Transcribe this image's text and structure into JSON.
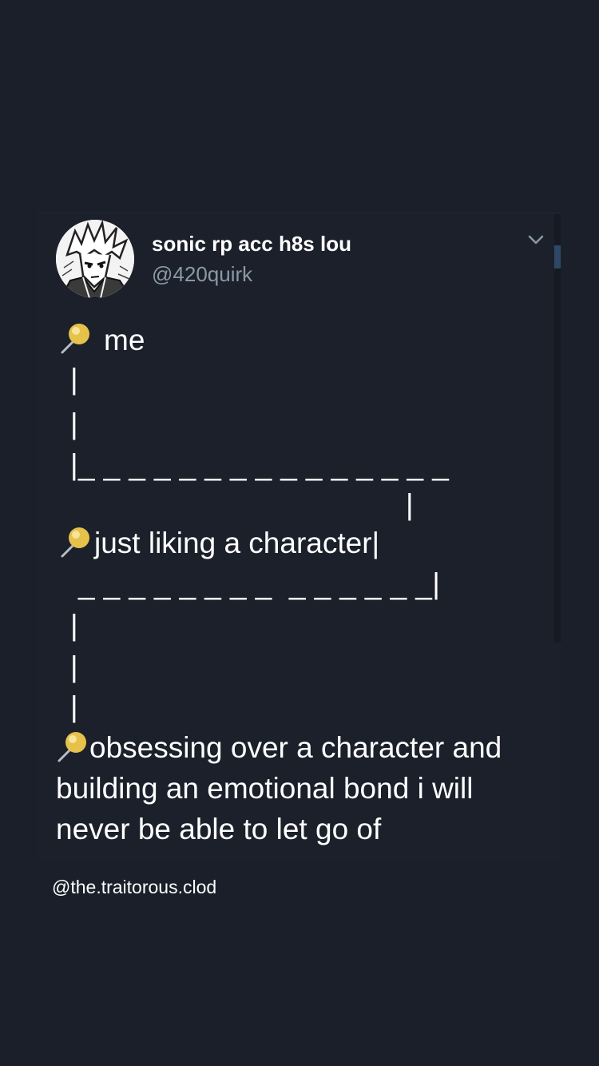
{
  "tweet": {
    "display_name": "sonic rp acc h8s lou",
    "handle": "@420quirk",
    "avatar_icon": "manga-character-avatar",
    "menu_icon": "chevron-down-icon",
    "pin_icon": "round-pushpin-emoji",
    "lines": {
      "me": "me",
      "bar": "|",
      "corner_dash": "|_ _ _ _ _ _ _ _ _ _ _ _ _ _ _",
      "right_bar": "|",
      "middle": "just liking a character|",
      "dash_row": "_ _ _ _ _ _ _ _  _ _ _ _ _ _|"
    },
    "final": "obsessing over a character and building an emotional bond i will never be able to let go of"
  },
  "credit": "@the.traitorous.clod",
  "colors": {
    "background": "#1a1f29",
    "text": "#ffffff",
    "secondary_text": "#8b98a5",
    "pin_head": "#e8c450"
  }
}
